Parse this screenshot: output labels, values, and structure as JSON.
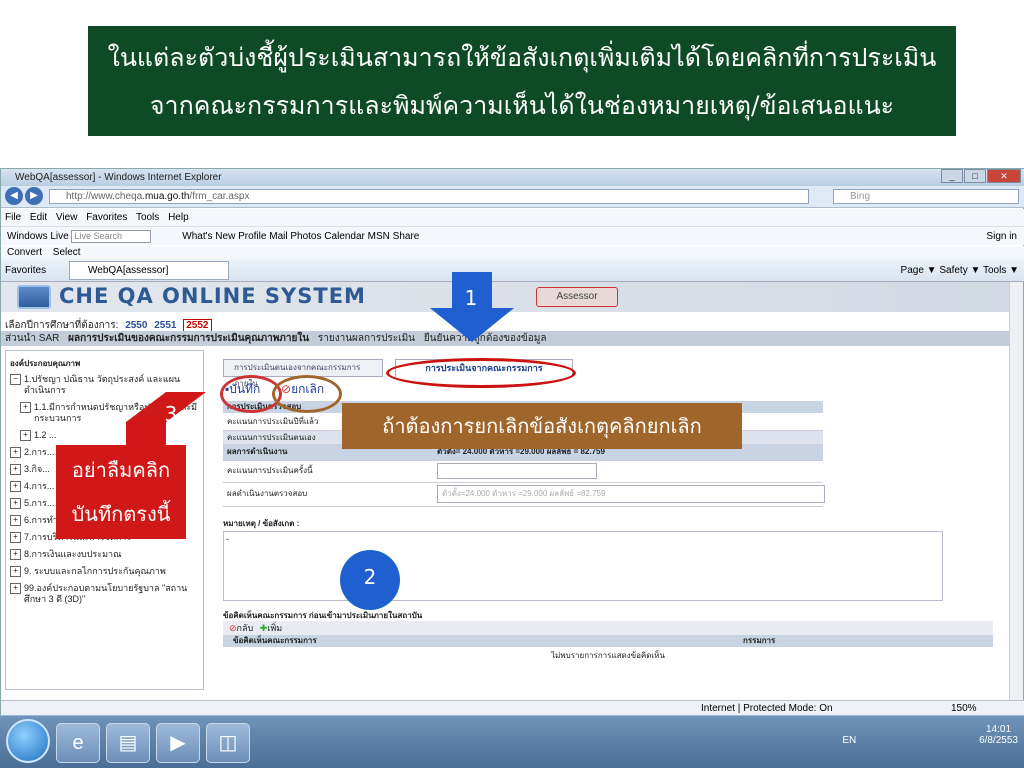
{
  "banner": {
    "line1": "ในแต่ละตัวบ่งชี้ผู้ประเมินสามารถให้ข้อสังเกตุเพิ่มเติมได้โดยคลิกที่การประเมิน",
    "line2": "จากคณะกรรมการและพิมพ์ความเห็นได้ในช่องหมายเหตุ/ข้อเสนอแนะ"
  },
  "browser": {
    "title": "WebQA[assessor] - Windows Internet Explorer",
    "url_prefix": "http://www.cheqa.",
    "url_host": "mua.go.th",
    "url_path": "/frm_car.aspx",
    "search_placeholder": "Bing",
    "menu": [
      "File",
      "Edit",
      "View",
      "Favorites",
      "Tools",
      "Help"
    ],
    "links": {
      "windows_live": "Windows Live",
      "live_search": "Live Search",
      "items": [
        "What's New",
        "Profile",
        "Mail",
        "Photos",
        "Calendar",
        "MSN",
        "Share"
      ],
      "sign_in": "Sign in"
    },
    "convert": "Convert",
    "select": "Select",
    "favorites": "Favorites",
    "tab_title": "WebQA[assessor]",
    "cmd": "Page ▼  Safety ▼  Tools ▼",
    "status_zone": "Internet | Protected Mode: On",
    "zoom": "150%"
  },
  "app": {
    "logo": "CHE QA ONLINE SYSTEM",
    "assessor": "Assessor",
    "year_label": "เลือกปีการศึกษาที่ต้องการ:",
    "years": [
      "2550",
      "2551",
      "2552"
    ],
    "nav": [
      "ส่วนนำ SAR",
      "ผลการประเมินของคณะกรรมการประเมินคุณภาพภายใน",
      "รายงานผลการประเมิน",
      "ยืนยันความถูกต้องของข้อมูล"
    ],
    "side_header": "องค์ประกอบคุณภาพ",
    "side_items": [
      "1.ปรัชญา ปณิธาน วัตถุประสงค์ และแผนดำเนินการ",
      "1.1.มีการกำหนดปรัชญาหรือปณิธานและมีกระบวนการ",
      "1.2 ...",
      "2.การ...",
      "3.กิจ...",
      "4.การ...",
      "5.การ...",
      "6.การทำนุบำรุงศิลปวัฒนธรรม",
      "7.การบริหารและการจัดการ",
      "8.การเงินและงบประมาณ",
      "9. ระบบและกลไกการประกันคุณภาพ",
      "99.องค์ประกอบตามนโยบายรัฐบาล \"สถานศึกษา 3 ดี (3D)\""
    ],
    "tab_self": "การประเมินตนเองจากคณะกรรมการภายใน",
    "tab_committee": "การประเมินจากคณะกรรมการ",
    "save": "บันทึก",
    "cancel": "ยกเลิก",
    "section_title": "การประเมินตรวจสอบ",
    "rows": [
      {
        "label": "คะแนนการประเมินปีที่แล้ว",
        "value": ""
      },
      {
        "label": "คะแนนการประเมินตนเอง",
        "value": ""
      },
      {
        "label": "ผลการดำเนินงาน",
        "value": "ตัวตั้ง= 24.000  ตัวหาร =29.000  ผลลัพธ์ = 82.759"
      },
      {
        "label": "คะแนนการประเมินครั้งนี้",
        "value": ""
      },
      {
        "label": "ผลดำเนินงานตรวจสอบ",
        "value": "ตัวตั้ง=24.000  ตัวหาร =29.000  ผลลัพธ์ =82.759"
      }
    ],
    "note_label": "หมายเหตุ / ข้อสังเกต :",
    "note_value": "-",
    "comment_label": "ข้อคิดเห็นคณะกรรมการ ก่อนเข้ามาประเมินภายในสถาบัน",
    "comment_back": "กลับ",
    "comment_add": "เพิ่ม",
    "comment_col1": "ข้อคิดเห็นคณะกรรมการ",
    "comment_col2": "กรรมการ",
    "comment_empty": "ไม่พบรายการการแสดงข้อคิดเห็น"
  },
  "callouts": {
    "n1": "1",
    "n2": "2",
    "n3": "3",
    "cancel_hint": "ถ้าต้องการยกเลิกข้อสังเกตุคลิกยกเลิก",
    "save_hint_1": "อย่าลืมคลิก",
    "save_hint_2": "บันทึกตรงนี้"
  },
  "taskbar": {
    "lang": "EN",
    "time": "14:01",
    "date": "6/8/2553"
  },
  "colors": {
    "banner_bg": "#0e4a24",
    "callout_brown": "#a0652a",
    "callout_red": "#d01818",
    "arrow_blue": "#1f5fd0",
    "ellipse_red": "#cc1111"
  }
}
